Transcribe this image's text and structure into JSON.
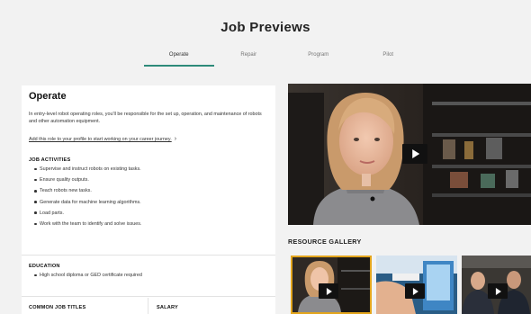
{
  "page": {
    "title": "Job Previews"
  },
  "tabs": [
    {
      "label": "Operate",
      "active": true
    },
    {
      "label": "Repair",
      "active": false
    },
    {
      "label": "Program",
      "active": false
    },
    {
      "label": "Pilot",
      "active": false
    }
  ],
  "job": {
    "title": "Operate",
    "description": "In entry-level robot operating roles, you'll be responsible for the set up, operation, and maintenance of robots and other automation equipment.",
    "link_text": "Add this role to your profile to start working on your career journey.",
    "link_chevron": "›",
    "activities_heading": "JOB ACTIVITIES",
    "activities": [
      "Supervise and instruct robots on existing tasks.",
      "Ensure quality outputs.",
      "Teach robots new tasks.",
      "Generate data for machine learning algorithms.",
      "Load parts.",
      "Work with the team to identify and solve issues."
    ],
    "education_heading": "EDUCATION",
    "education": "High school diploma or GED certificate required",
    "common_titles_heading": "COMMON JOB TITLES",
    "salary_heading": "SALARY"
  },
  "video": {
    "play_icon": "play-icon"
  },
  "gallery": {
    "title": "RESOURCE GALLERY",
    "thumbnails": [
      {
        "selected": true,
        "accent": "#e3a51c"
      },
      {
        "selected": false
      },
      {
        "selected": false
      }
    ]
  },
  "colors": {
    "accent_tab": "#2e8b7a",
    "thumb_selected": "#e3a51c",
    "background": "#f2f2f2"
  }
}
